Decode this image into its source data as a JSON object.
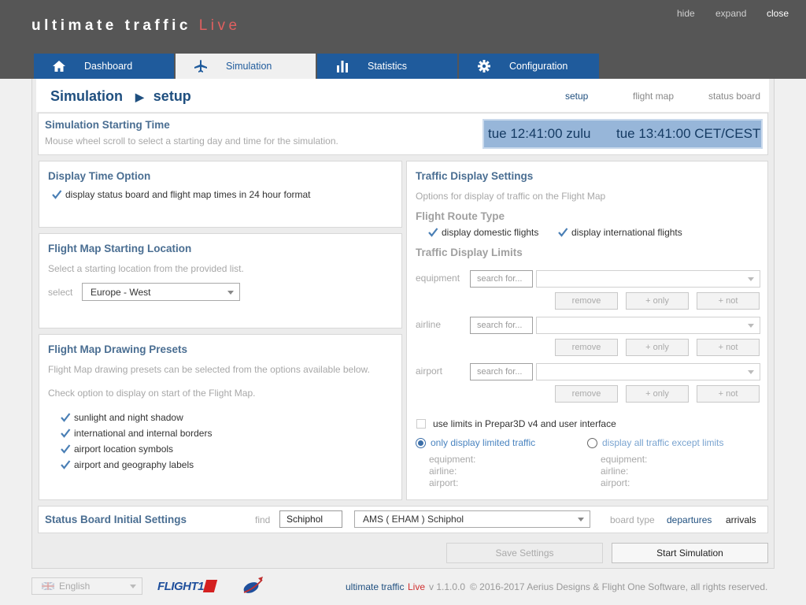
{
  "app": {
    "title_main": "ultimate traffic",
    "title_live": "Live"
  },
  "window_controls": {
    "hide": "hide",
    "expand": "expand",
    "close": "close"
  },
  "tabs": [
    {
      "label": "Dashboard",
      "icon": "home-icon"
    },
    {
      "label": "Simulation",
      "icon": "airplane-icon"
    },
    {
      "label": "Statistics",
      "icon": "bar-chart-icon"
    },
    {
      "label": "Configuration",
      "icon": "gear-icon"
    }
  ],
  "active_tab": "Simulation",
  "breadcrumb": {
    "section": "Simulation",
    "page": "setup"
  },
  "subnav": {
    "setup": "setup",
    "flight_map": "flight map",
    "status_board": "status board"
  },
  "start_time": {
    "title": "Simulation Starting Time",
    "hint": "Mouse wheel scroll to select a starting day and time for the simulation.",
    "zulu": "tue 12:41:00 zulu",
    "local": "tue 13:41:00 CET/CEST"
  },
  "display_time": {
    "title": "Display Time Option",
    "checkbox_label": "display status board and flight map times in 24 hour format",
    "checked": true
  },
  "start_location": {
    "title": "Flight Map Starting Location",
    "hint": "Select a starting location from the provided list.",
    "select_label": "select",
    "selected": "Europe - West"
  },
  "presets": {
    "title": "Flight Map Drawing Presets",
    "hint1": "Flight Map drawing presets can be selected from the options available below.",
    "hint2": "Check option to display on start of the Flight Map.",
    "items": [
      {
        "label": "sunlight and night shadow",
        "checked": true
      },
      {
        "label": "international and internal borders",
        "checked": true
      },
      {
        "label": "airport location symbols",
        "checked": true
      },
      {
        "label": "airport and geography labels",
        "checked": true
      }
    ]
  },
  "traffic": {
    "title": "Traffic Display Settings",
    "hint": "Options for display of traffic on the Flight Map",
    "route_type_title": "Flight Route Type",
    "domestic_label": "display domestic flights",
    "international_label": "display international flights",
    "limits_title": "Traffic Display Limits",
    "search_placeholder": "search for...",
    "remove_label": "remove",
    "only_label": "+ only",
    "not_label": "+ not",
    "rows": [
      {
        "label": "equipment"
      },
      {
        "label": "airline"
      },
      {
        "label": "airport"
      }
    ],
    "use_limits_label": "use limits in Prepar3D v4 and user interface",
    "use_limits_checked": false,
    "only_limited_label": "only display limited traffic",
    "all_except_label": "display all traffic except limits",
    "summary_labels": [
      "equipment:",
      "airline:",
      "airport:"
    ]
  },
  "status_board": {
    "title": "Status Board Initial Settings",
    "find_label": "find",
    "find_value": "Schiphol",
    "airport_selected": "AMS ( EHAM ) Schiphol",
    "board_type_label": "board type",
    "departures": "departures",
    "arrivals": "arrivals"
  },
  "actions": {
    "save": "Save Settings",
    "start": "Start Simulation"
  },
  "footer": {
    "language": "English",
    "flight1_logo": "FLIGHT1",
    "product_main": "ultimate traffic",
    "product_live": "Live",
    "version": "v 1.1.0.0",
    "copyright": "© 2016-2017 Aerius Designs & Flight One Software, all rights reserved."
  },
  "colors": {
    "accent": "#1f5b9c",
    "header": "#565656",
    "live": "#e06060",
    "clock_bg": "#97b6d9"
  }
}
